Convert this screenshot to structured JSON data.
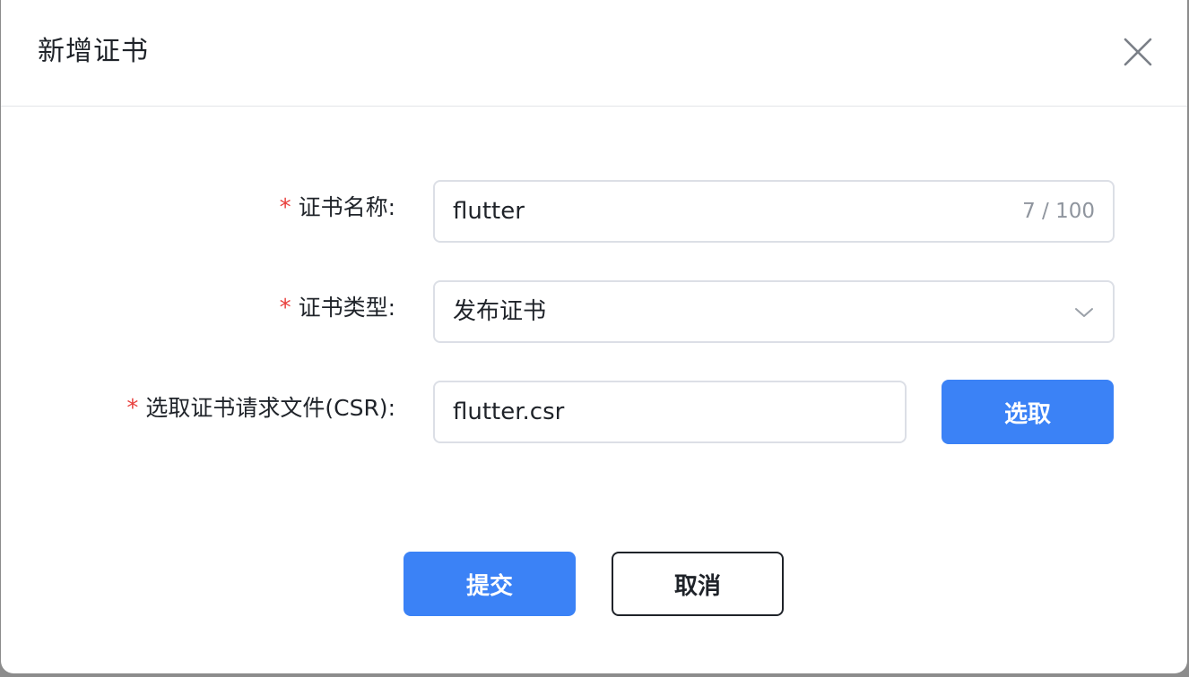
{
  "dialog": {
    "title": "新增证书",
    "close_icon": "close-icon"
  },
  "form": {
    "name": {
      "required_mark": "*",
      "label": "证书名称:",
      "value": "flutter",
      "counter": "7 / 100"
    },
    "type": {
      "required_mark": "*",
      "label": "证书类型:",
      "value": "发布证书",
      "icon": "chevron-down-icon"
    },
    "csr": {
      "required_mark": "*",
      "label": "选取证书请求文件(CSR):",
      "value": "flutter.csr",
      "pick_label": "选取"
    }
  },
  "footer": {
    "submit_label": "提交",
    "cancel_label": "取消"
  },
  "colors": {
    "primary": "#3b82f6",
    "required": "#e8403d",
    "border": "#dcdfe6"
  }
}
